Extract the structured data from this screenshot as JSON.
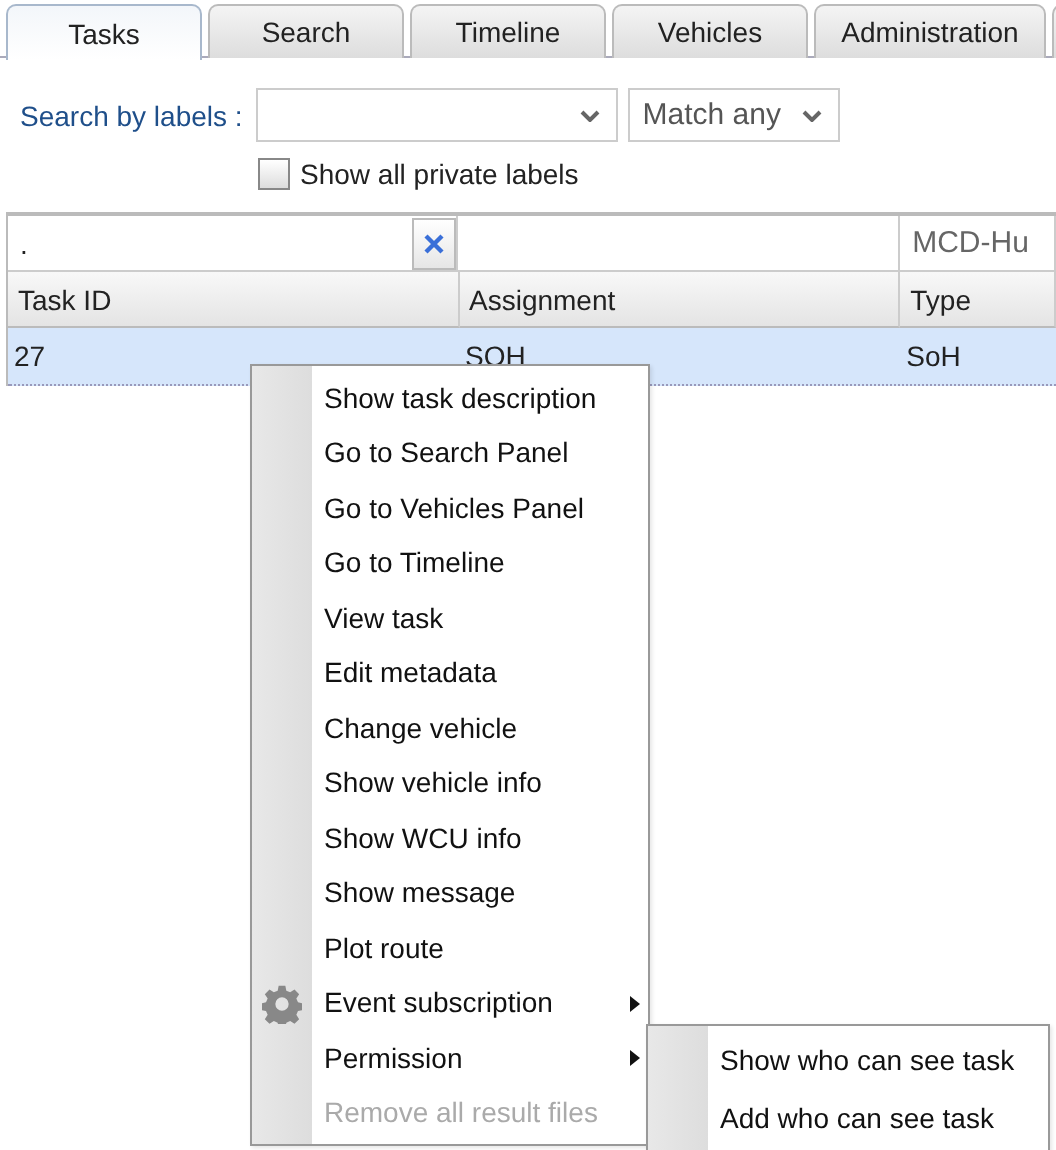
{
  "tabs": [
    {
      "label": "Tasks",
      "selected": true
    },
    {
      "label": "Search",
      "selected": false
    },
    {
      "label": "Timeline",
      "selected": false
    },
    {
      "label": "Vehicles",
      "selected": false
    },
    {
      "label": "Administration",
      "selected": false
    }
  ],
  "label_search": {
    "label": "Search by labels :",
    "match": "Match any"
  },
  "private_labels": {
    "label": "Show all private labels",
    "checked": false
  },
  "grid": {
    "filters": [
      ".",
      "MCD-Hu"
    ],
    "columns": [
      "Task ID",
      "Assignment",
      "Type"
    ],
    "rows": [
      {
        "cells": [
          "27",
          "SOH",
          "SoH"
        ],
        "selected": true
      }
    ]
  },
  "context_menu": [
    {
      "label": "Show task description",
      "icon": false,
      "submenu": false,
      "disabled": false
    },
    {
      "label": "Go to Search Panel",
      "icon": false,
      "submenu": false,
      "disabled": false
    },
    {
      "label": "Go to Vehicles Panel",
      "icon": false,
      "submenu": false,
      "disabled": false
    },
    {
      "label": "Go to Timeline",
      "icon": false,
      "submenu": false,
      "disabled": false
    },
    {
      "label": "View task",
      "icon": false,
      "submenu": false,
      "disabled": false
    },
    {
      "label": "Edit metadata",
      "icon": false,
      "submenu": false,
      "disabled": false
    },
    {
      "label": "Change vehicle",
      "icon": false,
      "submenu": false,
      "disabled": false
    },
    {
      "label": "Show vehicle info",
      "icon": false,
      "submenu": false,
      "disabled": false
    },
    {
      "label": "Show WCU info",
      "icon": false,
      "submenu": false,
      "disabled": false
    },
    {
      "label": "Show message",
      "icon": false,
      "submenu": false,
      "disabled": false
    },
    {
      "label": "Plot route",
      "icon": false,
      "submenu": false,
      "disabled": false
    },
    {
      "label": "Event subscription",
      "icon": true,
      "submenu": true,
      "disabled": false
    },
    {
      "label": "Permission",
      "icon": false,
      "submenu": true,
      "disabled": false
    },
    {
      "label": "Remove all result files",
      "icon": false,
      "submenu": false,
      "disabled": true
    }
  ],
  "submenu": [
    "Show who can see task",
    "Add who can see task"
  ]
}
